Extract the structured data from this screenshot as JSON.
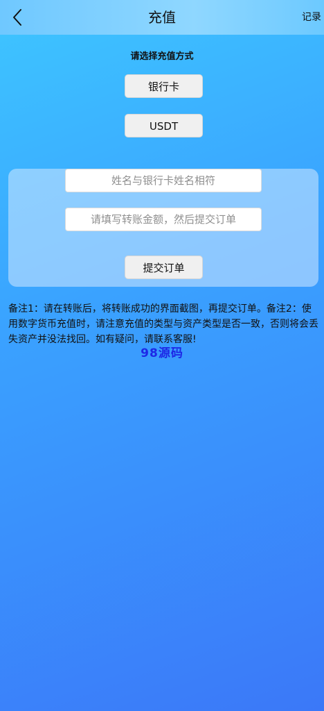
{
  "header": {
    "title": "充值",
    "records_label": "记录"
  },
  "method": {
    "title": "请选择充值方式",
    "bank_label": "银行卡",
    "usdt_label": "USDT"
  },
  "form": {
    "name_placeholder": "姓名与银行卡姓名相符",
    "amount_placeholder": "请填写转账金额，然后提交订单",
    "submit_label": "提交订单"
  },
  "note": "备注1：请在转账后，将转账成功的界面截图，再提交订单。备注2：使用数字货币充值时，请注意充值的类型与资产类型是否一致，否则将会丢失资产并没法找回。如有疑问，请联系客服!",
  "watermark": "98源码",
  "icons": {
    "back": "chevron-left-icon"
  },
  "colors": {
    "watermark": "#1d27e6"
  }
}
